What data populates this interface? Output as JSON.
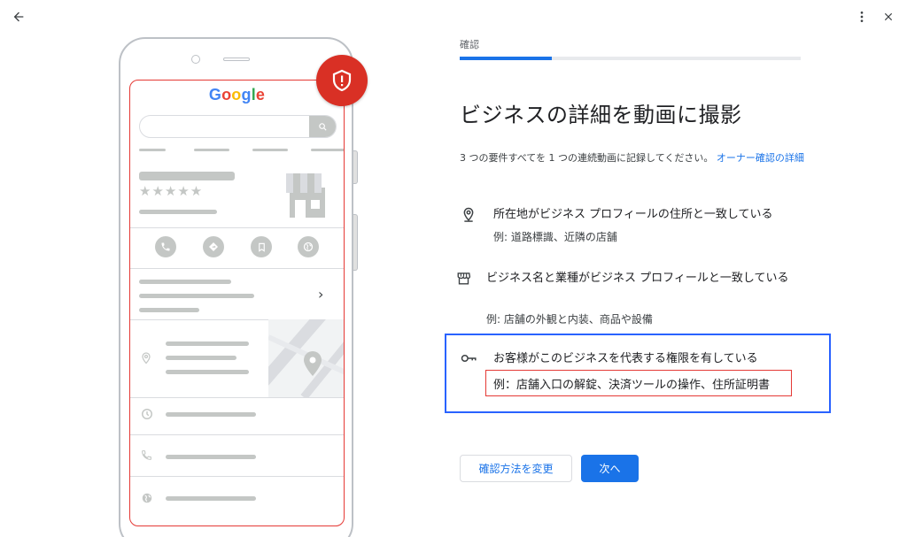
{
  "toolbar": {
    "back_icon": "arrow-back-icon",
    "more_icon": "more-vert-icon",
    "close_icon": "close-icon"
  },
  "illustration": {
    "logo_text": "Google",
    "logo_colors": [
      "#4285F4",
      "#EA4335",
      "#FBBC05",
      "#4285F4",
      "#34A853",
      "#EA4335"
    ],
    "rating": "★★★★★",
    "badge_icon": "shield-alert-icon",
    "badge_color": "#D93025",
    "screen_outline_color": "#E53935",
    "chevron": "›"
  },
  "step": {
    "label": "確認",
    "progress": 0.27
  },
  "page": {
    "title": "ビジネスの詳細を動画に撮影",
    "description": "3 つの要件すべてを 1 つの連続動画に記録してください。",
    "description_link": "オーナー確認の詳細"
  },
  "requirements": [
    {
      "icon": "location-pin-icon",
      "title": "所在地がビジネス プロフィールの住所と一致している",
      "example": "例: 道路標識、近隣の店舗"
    },
    {
      "icon": "storefront-icon",
      "title": "ビジネス名と業種がビジネス プロフィールと一致している",
      "example": "例: 店舗の外観と内装、商品や設備"
    },
    {
      "icon": "key-icon",
      "title": "お客様がこのビジネスを代表する権限を有している",
      "example": "例：店舗入口の解錠、決済ツールの操作、住所証明書"
    }
  ],
  "buttons": {
    "change_method": "確認方法を変更",
    "next": "次へ"
  },
  "colors": {
    "accent": "#1A73E8",
    "highlight_blue": "#2962FF",
    "highlight_red": "#E53935"
  }
}
